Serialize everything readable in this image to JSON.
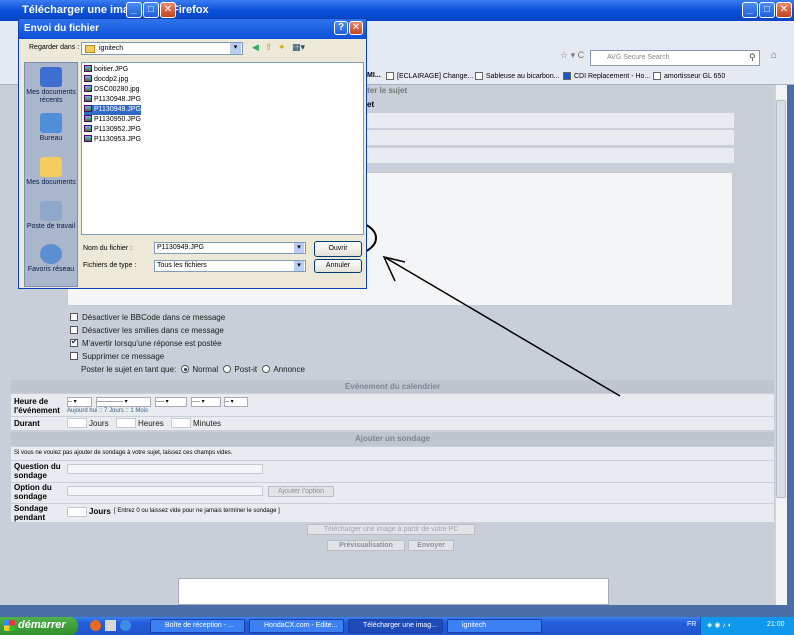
{
  "firefox": {
    "title": "Télécharger une image...",
    "app_name": "Firefox",
    "search_placeholder": "AVG Secure Search",
    "bookmarks": [
      "[ECLAIRAGE] Change...",
      "Sableuse au bicarbon...",
      "CDI Replacement - Ho...",
      "amortisseur GL 650"
    ],
    "bookmark_left_fragment": "AMI..."
  },
  "page": {
    "heading_fragment": "diter le sujet",
    "heading_fragment2": "et",
    "options": [
      {
        "label": "Désactiver le BBCode dans ce message",
        "checked": false
      },
      {
        "label": "Désactiver les smilies dans ce message",
        "checked": false
      },
      {
        "label": "M'avertir lorsqu'une réponse est postée",
        "checked": true
      },
      {
        "label": "Supprimer ce message",
        "checked": false
      }
    ],
    "post_type_label": "Poster le sujet en tant que:",
    "post_types": [
      "Normal",
      "Post-it",
      "Annonce"
    ],
    "calendar_header": "Evénement du calendrier",
    "event_time_label": "Heure de l'événement",
    "selects": [
      "--",
      "-------------",
      "----",
      "----",
      "--"
    ],
    "quick_links": "Aujourd hui :: 7 Jours :: 1 Mois",
    "duration_label": "Durant",
    "duration_units": [
      "Jours",
      "Heures",
      "Minutes"
    ],
    "poll_header": "Ajouter un sondage",
    "poll_hint": "Si vous ne voulez pas ajouter de sondage à votre sujet, laissez ces champs vides.",
    "poll_question_label": "Question du sondage",
    "poll_option_label": "Option du sondage",
    "add_option_button": "Ajouter l'option",
    "poll_duration_label": "Sondage pendant",
    "poll_days_label": "Jours",
    "poll_days_hint": "[ Entrez 0 ou laissez vide pour ne jamais terminer le sondage ]",
    "upload_button": "Télécharger une image à partir de votre PC",
    "preview_button": "Prévisualisation",
    "send_button": "Envoyer"
  },
  "dialog": {
    "title": "Envoi du fichier",
    "look_in_label": "Regarder dans :",
    "look_in_value": "ignitech",
    "places": [
      "Mes documents récents",
      "Bureau",
      "Mes documents",
      "Poste de travail",
      "Favoris réseau"
    ],
    "files": [
      "boitier.JPG",
      "docdp2.jpg",
      "DSC00280.jpg",
      "P1130948.JPG",
      "P1130949.JPG",
      "P1130950.JPG",
      "P1130952.JPG",
      "P1130953.JPG"
    ],
    "selected_file": "P1130949.JPG",
    "filename_label": "Nom du fichier :",
    "filename_value": "P1130949.JPG",
    "filetype_label": "Fichiers de type :",
    "filetype_value": "Tous les fichiers",
    "open_button": "Ouvrir",
    "cancel_button": "Annuler"
  },
  "taskbar": {
    "start_label": "démarrer",
    "tasks": [
      "Boîte de réception - ...",
      "HondaCX.com - Edite...",
      "Télécharger une imag...",
      "ignitech"
    ],
    "lang": "FR",
    "clock": "21:00"
  },
  "colors": {
    "xp_blue": "#0b4fd6",
    "selection": "#316ac5",
    "page_bg": "#c9cfd8"
  }
}
